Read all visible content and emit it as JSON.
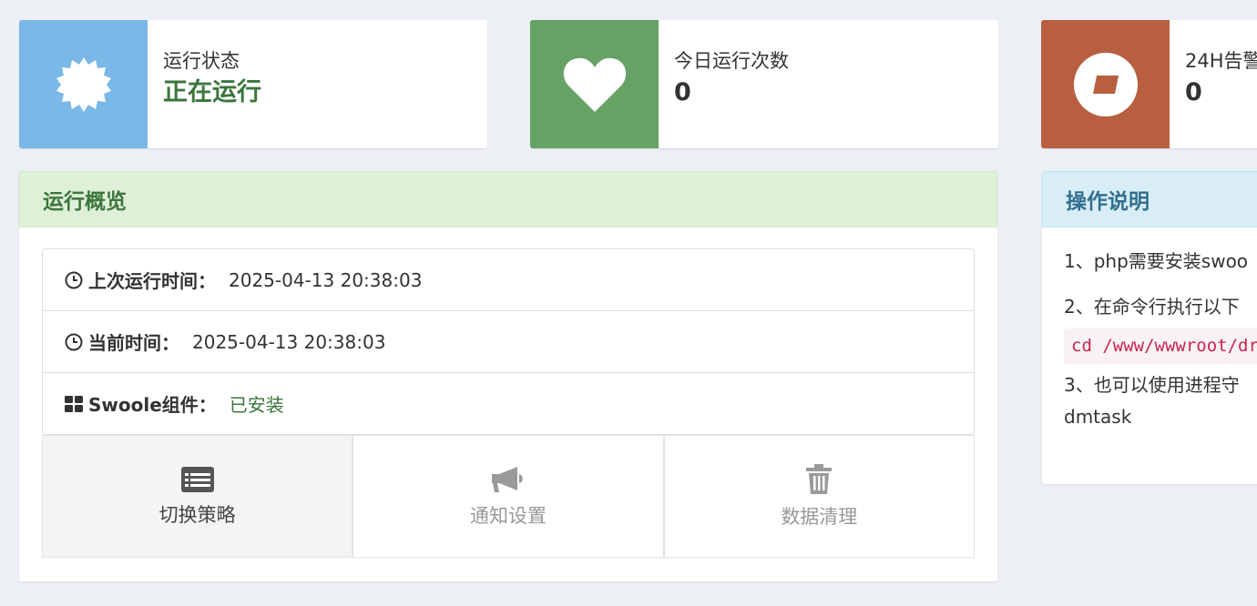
{
  "stats": [
    {
      "label": "运行状态",
      "value": "正在运行",
      "color": "#7ab8e8",
      "icon": "badge-icon"
    },
    {
      "label": "今日运行次数",
      "value": "0",
      "color": "#66a266",
      "icon": "heart-icon"
    },
    {
      "label": "24H告警",
      "value": "0",
      "color": "#b85f42",
      "icon": "compass-icon"
    }
  ],
  "overview": {
    "title": "运行概览",
    "items": [
      {
        "label": "上次运行时间：",
        "value": "2025-04-13 20:38:03",
        "icon": "clock-icon"
      },
      {
        "label": "当前时间：",
        "value": "2025-04-13 20:38:03",
        "icon": "clock-icon"
      },
      {
        "label": "Swoole组件：",
        "value": "已安装",
        "icon": "grid-icon"
      }
    ],
    "buttons": [
      {
        "label": "切换策略",
        "icon": "list-icon"
      },
      {
        "label": "通知设置",
        "icon": "megaphone-icon"
      },
      {
        "label": "数据清理",
        "icon": "trash-icon"
      }
    ]
  },
  "instructions": {
    "title": "操作说明",
    "line1": "1、php需要安装swoo",
    "line2": "2、在命令行执行以下",
    "code": "cd /www/wwwroot/dr",
    "line3": "3、也可以使用进程守",
    "line4": "dmtask"
  }
}
